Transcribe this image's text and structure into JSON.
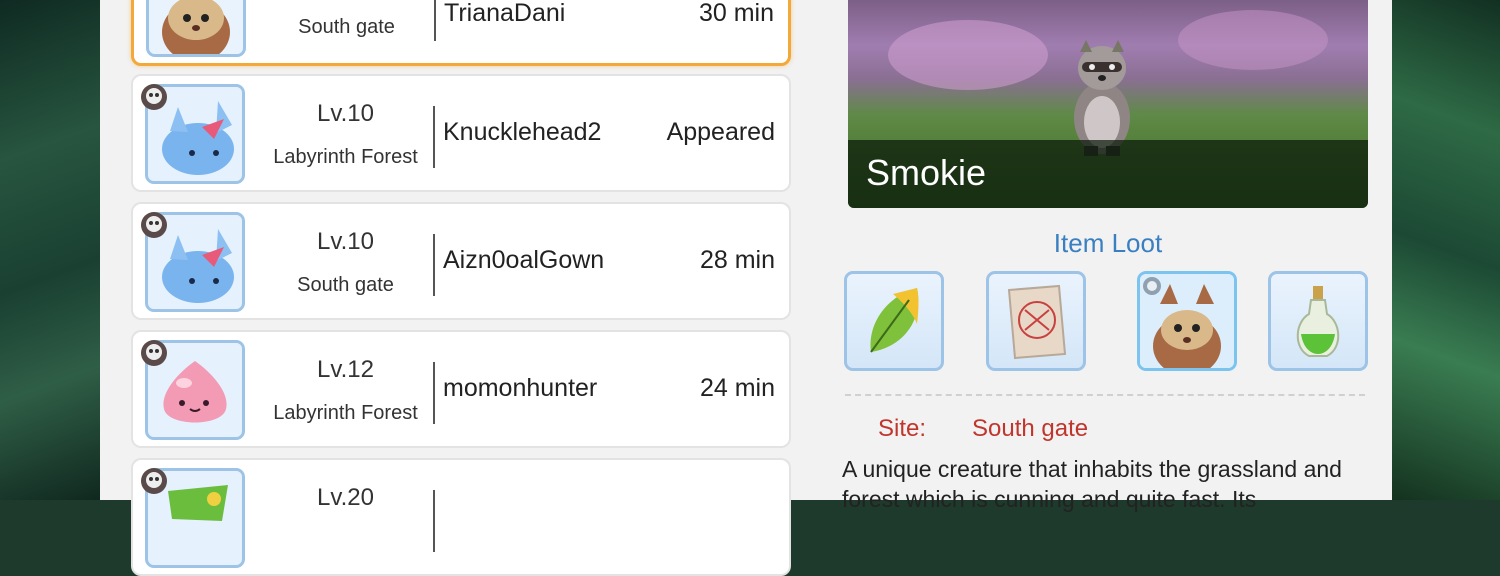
{
  "list": {
    "rows": [
      {
        "level": "",
        "map": "South gate",
        "player": "TrianaDani",
        "time": "30 min",
        "monster_icon": "smokie-portrait",
        "mvp_icon": "skull-badge-icon"
      },
      {
        "level": "Lv.10",
        "map": "Labyrinth Forest",
        "player": "Knucklehead2",
        "time": "Appeared",
        "monster_icon": "blue-furry-creature-portrait",
        "mvp_icon": "skull-badge-icon"
      },
      {
        "level": "Lv.10",
        "map": "South gate",
        "player": "Aizn0oalGown",
        "time": "28 min",
        "monster_icon": "blue-furry-creature-portrait",
        "mvp_icon": "skull-badge-icon"
      },
      {
        "level": "Lv.12",
        "map": "Labyrinth Forest",
        "player": "momonhunter",
        "time": "24 min",
        "monster_icon": "pink-poring-portrait",
        "mvp_icon": "skull-badge-icon"
      },
      {
        "level": "Lv.20",
        "map": "",
        "player": "",
        "time": "",
        "monster_icon": "green-creature-portrait",
        "mvp_icon": "skull-badge-icon"
      }
    ]
  },
  "detail": {
    "monster_name": "Smokie",
    "loot_title": "Item Loot",
    "loot_items": [
      "leaf-icon",
      "scroll-icon",
      "smokie-card-icon",
      "green-potion-icon"
    ],
    "site_label": "Site:",
    "site_value": "South gate",
    "description": "A unique creature that inhabits the grassland and forest which is cunning and quite fast. Its"
  },
  "colors": {
    "selected_border": "#f2a93a",
    "portrait_border": "#9dc3e6",
    "loot_title": "#3a7fc1",
    "site_text": "#c0362c"
  }
}
